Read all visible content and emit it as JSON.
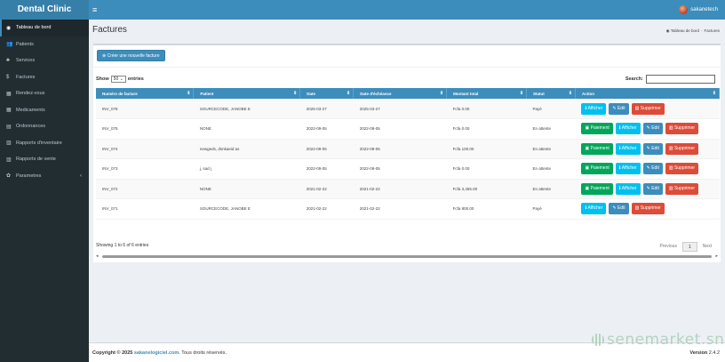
{
  "app": {
    "brand": "Dental Clinic",
    "menu_icon": "≡",
    "user_name": "sakanetech"
  },
  "sidebar": {
    "items": [
      {
        "icon": "dashboard-icon",
        "glyph": "◉",
        "label": "Tableau de bord"
      },
      {
        "icon": "users-icon",
        "glyph": "👥",
        "label": "Patients"
      },
      {
        "icon": "services-icon",
        "glyph": "♣",
        "label": "Services"
      },
      {
        "icon": "dollar-icon",
        "glyph": "$",
        "label": "Factures"
      },
      {
        "icon": "calendar-icon",
        "glyph": "▦",
        "label": "Rendez-vous"
      },
      {
        "icon": "medicine-icon",
        "glyph": "▦",
        "label": "Medicaments"
      },
      {
        "icon": "prescription-icon",
        "glyph": "▤",
        "label": "Ordonnances"
      },
      {
        "icon": "chart-icon",
        "glyph": "▥",
        "label": "Rapports d'inventaire"
      },
      {
        "icon": "chart-icon",
        "glyph": "▥",
        "label": "Rapports de vente"
      },
      {
        "icon": "gear-icon",
        "glyph": "✿",
        "label": "Parametres",
        "chevron": "‹"
      }
    ]
  },
  "page": {
    "title": "Factures",
    "breadcrumb": {
      "home": "Tableau de bord",
      "sep": "›",
      "current": "Factures"
    },
    "new_button": "Créer une nouvelle facture",
    "show_label": "Show",
    "show_value": "50",
    "show_suffix": "entries",
    "search_label": "Search:"
  },
  "table": {
    "columns": [
      "Numéro de facture",
      "Patient",
      "Date",
      "Date d'échéance",
      "Montant total",
      "Statut",
      "Action"
    ],
    "sort_glyph": "⇕",
    "action_labels": {
      "pay": "Paiement",
      "view": "Afficher",
      "edit": "Edit",
      "delete": "Supprimer"
    },
    "rows": [
      {
        "id": "INV_078",
        "patient": "SOURCECODE, JANOBE E",
        "date": "2025-03-27",
        "due": "2025-03-27",
        "total": "Fcfa 0.00",
        "status": "Payé",
        "pay": false
      },
      {
        "id": "INV_075",
        "patient": "NONE",
        "date": "2022-09-05",
        "due": "2022-09-05",
        "total": "Fcfa 0.00",
        "status": "En attente",
        "pay": true
      },
      {
        "id": "INV_074",
        "patient": "newgeds, dsnkaeid as",
        "date": "2022-09-05",
        "due": "2022-09-05",
        "total": "Fcfa 100.00",
        "status": "En attente",
        "pay": true
      },
      {
        "id": "INV_073",
        "patient": "j, sad j",
        "date": "2022-09-05",
        "due": "2022-09-05",
        "total": "Fcfa 0.00",
        "status": "En attente",
        "pay": true
      },
      {
        "id": "INV_072",
        "patient": "NONE",
        "date": "2021-02-22",
        "due": "2021-02-22",
        "total": "Fcfa 3,465.00",
        "status": "En attente",
        "pay": true
      },
      {
        "id": "INV_071",
        "patient": "SOURCECODE, JANOBE E",
        "date": "2021-02-22",
        "due": "2021-02-22",
        "total": "Fcfa 800.00",
        "status": "Payé",
        "pay": false
      }
    ],
    "info": "Showing 1 to 6 of 6 entries",
    "pager": {
      "prev": "Previous",
      "page": "1",
      "next": "Next"
    }
  },
  "footer": {
    "copyright": "Copyright © 2025",
    "link": "sakanelogiciel.com.",
    "rights": "Tous droits réservés.",
    "version_label": "Version",
    "version": "2.4.2"
  },
  "watermark": "senemarket.sn"
}
